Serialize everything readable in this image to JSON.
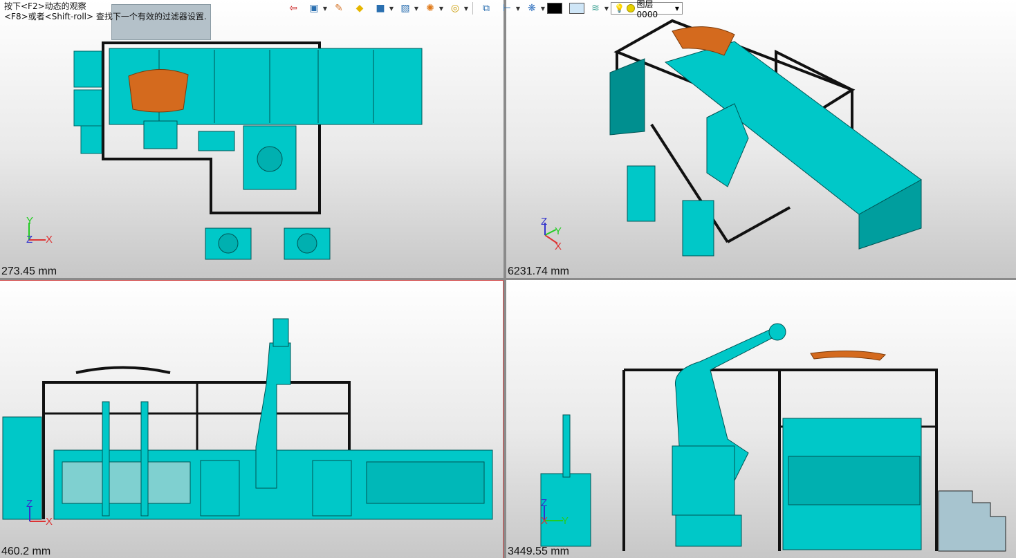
{
  "hints": {
    "line1": "按下<F2>动态的观察",
    "line2": "<F8>或者<Shift-roll> 查找下一个有效的过滤器设置."
  },
  "toolbar": {
    "buttons": [
      {
        "name": "exit-icon",
        "glyph": "⇦"
      },
      {
        "name": "view-icon",
        "glyph": "▣"
      },
      {
        "name": "pen-icon",
        "glyph": "✎"
      },
      {
        "name": "box-top-icon",
        "glyph": "◆"
      },
      {
        "name": "box-icon",
        "glyph": "■"
      },
      {
        "name": "box-front-icon",
        "glyph": "▧"
      },
      {
        "name": "render-icon",
        "glyph": "✺"
      },
      {
        "name": "zoom-icon",
        "glyph": "◎"
      },
      {
        "name": "section-icon",
        "glyph": "⧉"
      },
      {
        "name": "measure-icon",
        "glyph": "⊢"
      },
      {
        "name": "palette-icon",
        "glyph": "❋"
      }
    ],
    "color_swatch": "#000000",
    "bg_swatch": "#cfe6f7",
    "layer_label": "图层0000"
  },
  "viewports": [
    {
      "id": "top",
      "scale": "273.45 mm"
    },
    {
      "id": "iso",
      "scale": "6231.74 mm"
    },
    {
      "id": "front",
      "scale": "460.2 mm"
    },
    {
      "id": "side",
      "scale": "3449.55 mm"
    }
  ],
  "axes": {
    "x": "X",
    "y": "Y",
    "z": "Z"
  },
  "colors": {
    "machine": "#00c8c8",
    "machine_dark": "#008f8f",
    "part": "#d46a1e",
    "frame": "#111111"
  }
}
